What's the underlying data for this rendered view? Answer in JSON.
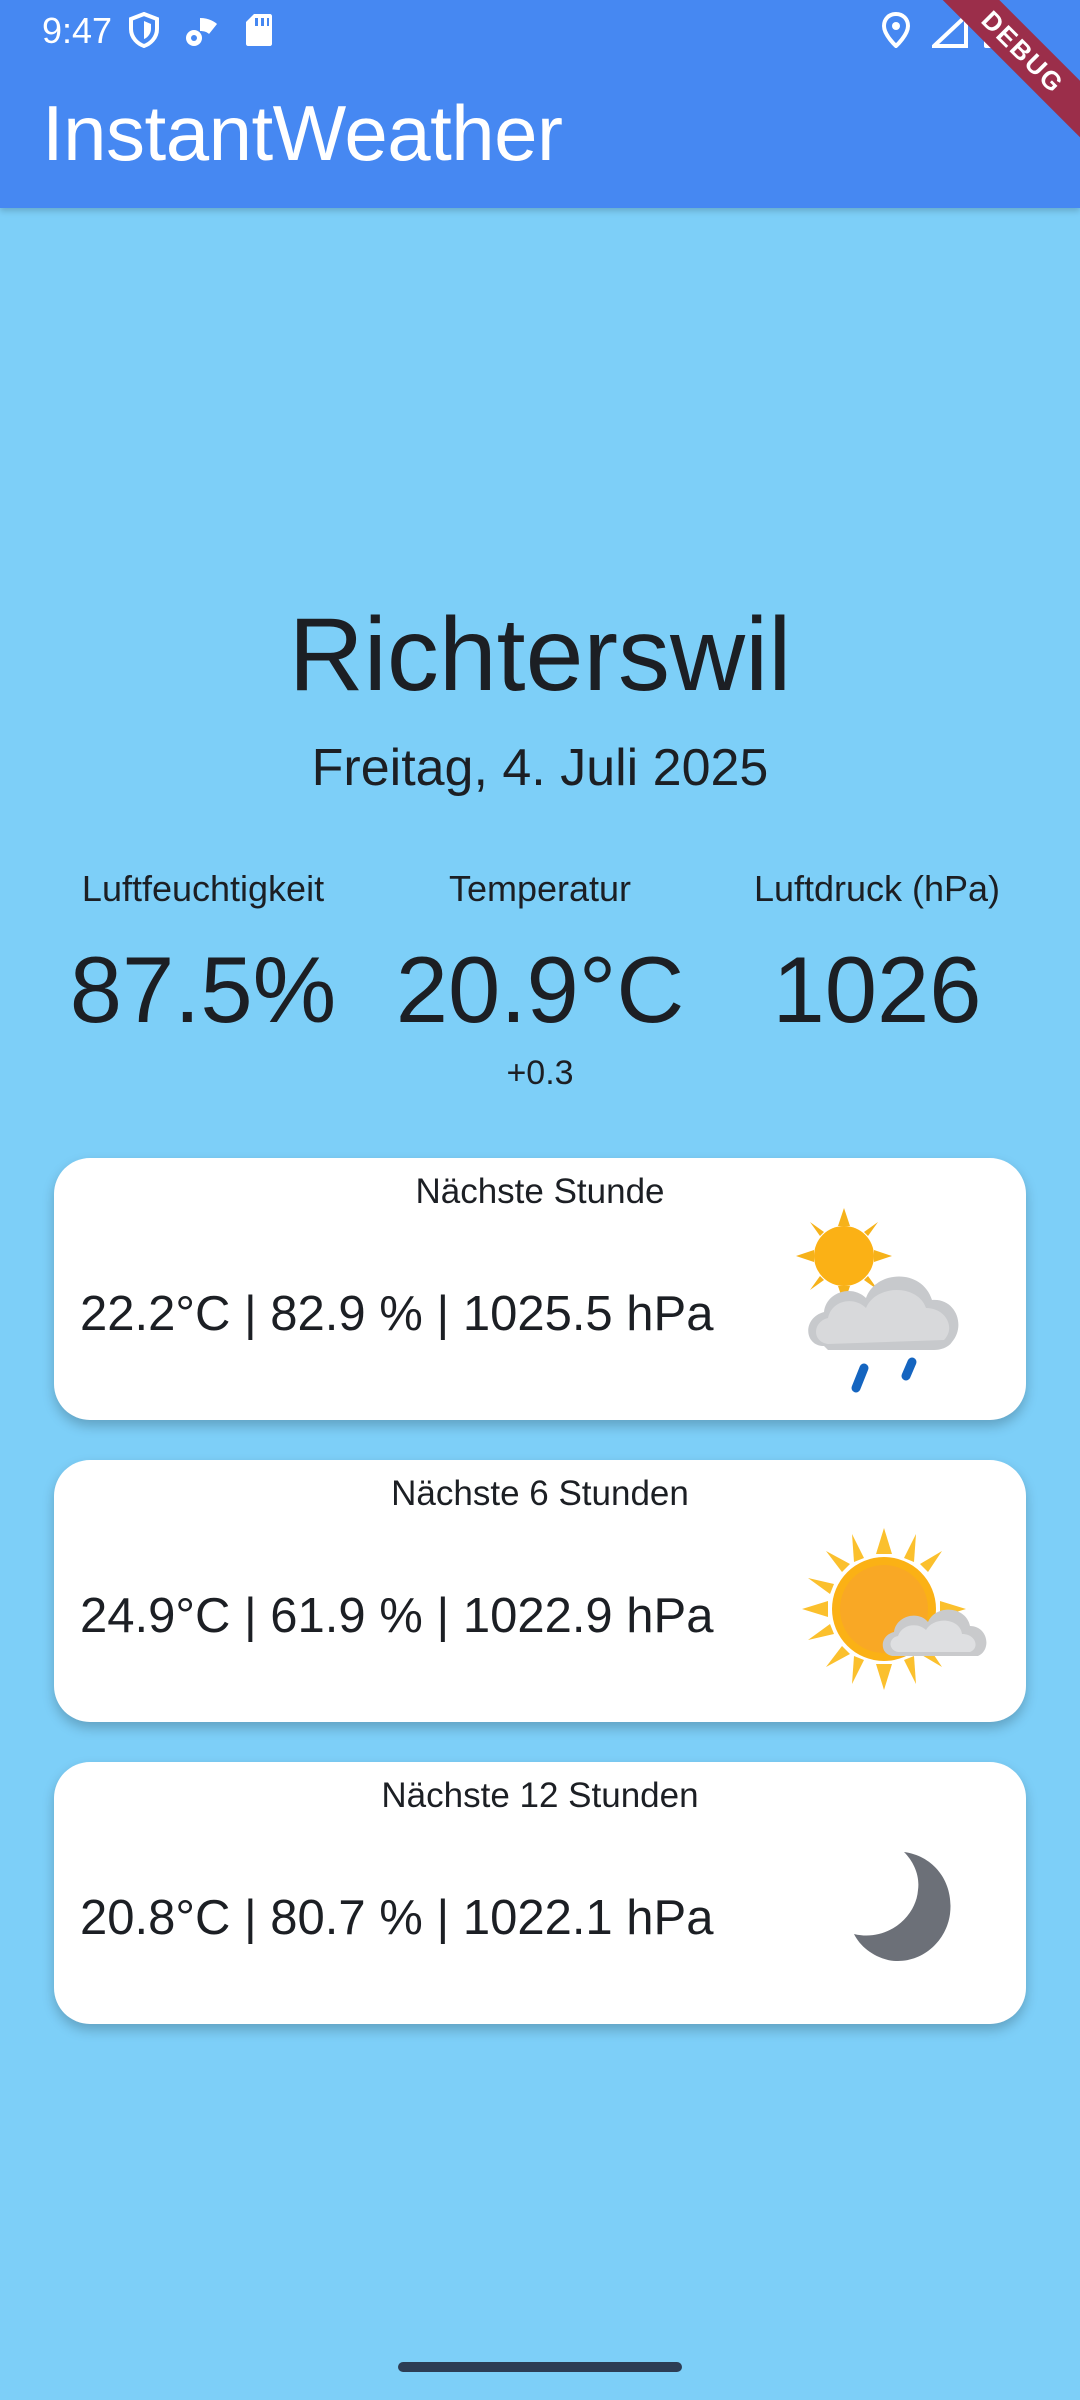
{
  "status_bar": {
    "time": "9:47"
  },
  "app_bar": {
    "title": "InstantWeather",
    "debug_label": "DEBUG"
  },
  "location": {
    "city": "Richterswil",
    "date": "Freitag, 4. Juli 2025"
  },
  "current": {
    "humidity": {
      "label": "Luftfeuchtigkeit",
      "value": "87.5%"
    },
    "temperature": {
      "label": "Temperatur",
      "value": "20.9°C",
      "delta": "+0.3"
    },
    "pressure": {
      "label": "Luftdruck (hPa)",
      "value": "1026"
    }
  },
  "forecasts": [
    {
      "title": "Nächste Stunde",
      "values": "22.2°C | 82.9 % | 1025.5 hPa",
      "icon": "sun-cloud-rain-icon"
    },
    {
      "title": "Nächste 6 Stunden",
      "values": "24.9°C | 61.9 % | 1022.9 hPa",
      "icon": "sun-behind-cloud-icon"
    },
    {
      "title": "Nächste 12 Stunden",
      "values": "20.8°C | 80.7 % | 1022.1 hPa",
      "icon": "moon-icon"
    }
  ],
  "colors": {
    "app_bar": "#4688f2",
    "background": "#7dcff8",
    "card": "#ffffff"
  }
}
